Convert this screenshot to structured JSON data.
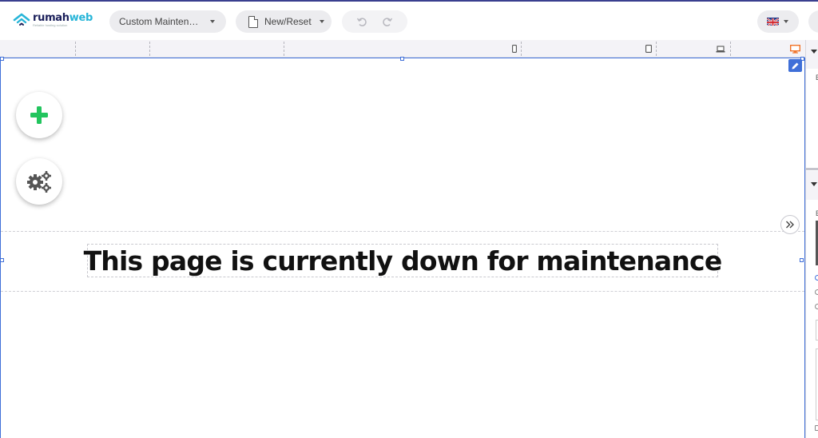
{
  "app": {
    "logo_text_primary": "rumah",
    "logo_text_accent": "web",
    "logo_tagline": "Reliable hosting solution"
  },
  "toolbar": {
    "template_dropdown_label": "Custom Maintenance",
    "new_reset_label": "New/Reset",
    "undo_icon": "undo-icon",
    "redo_icon": "redo-icon",
    "language_flag": "uk-flag-icon"
  },
  "ruler": {
    "devices": [
      "mobile-icon",
      "tablet-icon",
      "laptop-icon",
      "desktop-icon"
    ],
    "active_device": "desktop-icon",
    "active_color": "#f06a1a"
  },
  "canvas": {
    "heading_text": "This page is currently down for maintenance",
    "add_button_icon": "plus-icon",
    "settings_button_icon": "gears-icon",
    "collapse_button_icon": "double-chevron-right-icon",
    "edit_button_icon": "pencil-icon",
    "accent_color": "#3f6fd8",
    "add_color": "#22c55e"
  }
}
